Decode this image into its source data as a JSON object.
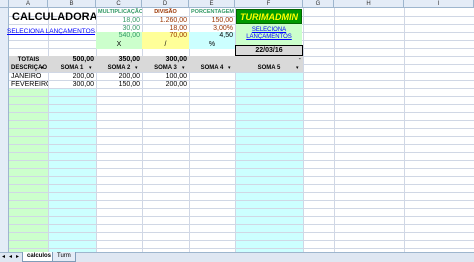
{
  "columns": [
    "A",
    "B",
    "C",
    "D",
    "E",
    "F",
    "G",
    "H",
    "I"
  ],
  "title": "CALCULADORA",
  "link": "SELECIONA LANÇAMENTOS",
  "ops": {
    "mult_label": "MULTIPLICAÇÃO",
    "div_label": "DIVISÃO",
    "pct_label": "PORCENTAGEM",
    "mult_a": "18,00",
    "mult_b": "30,00",
    "mult_result": "540,00",
    "mult_sym": "X",
    "div_a": "1.260,00",
    "div_b": "18,00",
    "div_result": "70,00",
    "div_sym": "/",
    "pct_a": "150,00",
    "pct_b": "3,00%",
    "pct_result": "4,50",
    "pct_sym": "%"
  },
  "logo": "TURIMADMIN",
  "logo_link": "SELECIONA LANÇAMENTOS",
  "date": "22/03/16",
  "totals": {
    "label": "TOTAIS",
    "b": "500,00",
    "c": "350,00",
    "d": "300,00",
    "g": "-"
  },
  "headers": [
    "DESCRIÇÃO",
    "SOMA 1",
    "SOMA 2",
    "SOMA 3",
    "SOMA 4",
    "SOMA 5"
  ],
  "rows": [
    {
      "desc": "JANEIRO",
      "b": "200,00",
      "c": "200,00",
      "d": "100,00"
    },
    {
      "desc": "FEVEREIRO",
      "b": "300,00",
      "c": "150,00",
      "d": "200,00"
    }
  ],
  "tabs": [
    "calculos",
    "Turm"
  ]
}
